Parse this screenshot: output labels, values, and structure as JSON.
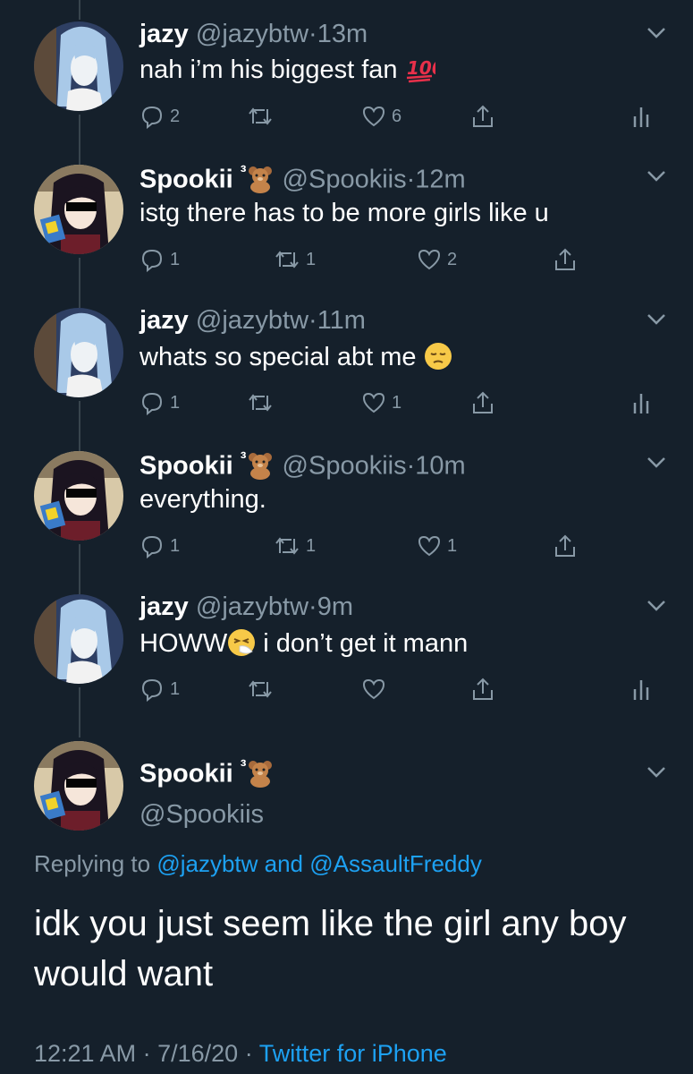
{
  "tweets": [
    {
      "name": "jazy",
      "handle": "@jazybtw",
      "time": "13m",
      "text": "nah i’m his biggest fan",
      "emoji": "hundred-points-icon",
      "replies": "2",
      "retweets": "",
      "likes": "6",
      "avatar": "avatar-jazy",
      "show_analytics": true,
      "badge": ""
    },
    {
      "name": "Spookii",
      "badge": "³",
      "handle": "@Spookiis",
      "time": "12m",
      "text": "istg there has to be more girls like u",
      "emoji": "",
      "replies": "1",
      "retweets": "1",
      "likes": "2",
      "avatar": "avatar-spookii",
      "show_analytics": false
    },
    {
      "name": "jazy",
      "handle": "@jazybtw",
      "time": "11m",
      "text": "whats so special abt me",
      "emoji": "pensive-face-icon",
      "replies": "1",
      "retweets": "",
      "likes": "1",
      "avatar": "avatar-jazy",
      "show_analytics": true,
      "badge": ""
    },
    {
      "name": "Spookii",
      "badge": "³",
      "handle": "@Spookiis",
      "time": "10m",
      "text": "everything.",
      "emoji": "",
      "replies": "1",
      "retweets": "1",
      "likes": "1",
      "avatar": "avatar-spookii",
      "show_analytics": false
    },
    {
      "name": "jazy",
      "handle": "@jazybtw",
      "time": "9m",
      "text_before": "HOWW",
      "text_after": " i don’t get it mann",
      "emoji": "sneezing-face-icon",
      "replies": "1",
      "retweets": "",
      "likes": "",
      "avatar": "avatar-jazy",
      "show_analytics": true,
      "badge": ""
    }
  ],
  "main": {
    "name": "Spookii",
    "badge": "³",
    "handle": "@Spookiis",
    "replying_prefix": "Replying to",
    "replying_to_1": "@jazybtw",
    "replying_and": "and",
    "replying_to_2": "@AssaultFreddy",
    "text": "idk you just seem like the girl any boy would want",
    "time": "12:21 AM",
    "date": "7/16/20",
    "source": "Twitter for iPhone"
  },
  "separator_dot": "·",
  "colors": {
    "background": "#15202b",
    "secondary": "#8899a6",
    "link": "#1da1f2",
    "thread_line": "#38444d"
  }
}
